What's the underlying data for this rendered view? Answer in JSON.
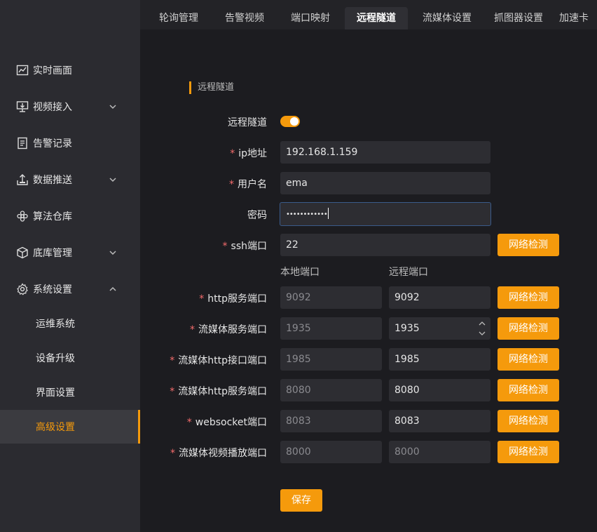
{
  "sidebar": {
    "items": [
      {
        "label": "实时画面",
        "icon": "chart-line-icon"
      },
      {
        "label": "视频接入",
        "icon": "monitor-icon"
      },
      {
        "label": "告警记录",
        "icon": "document-icon"
      },
      {
        "label": "数据推送",
        "icon": "upload-icon"
      },
      {
        "label": "算法仓库",
        "icon": "flower-icon"
      },
      {
        "label": "底库管理",
        "icon": "cube-icon"
      },
      {
        "label": "系统设置",
        "icon": "gear-icon"
      }
    ],
    "subitems": [
      {
        "label": "运维系统"
      },
      {
        "label": "设备升级"
      },
      {
        "label": "界面设置"
      },
      {
        "label": "高级设置"
      }
    ]
  },
  "tabs": [
    "轮询管理",
    "告警视频",
    "端口映射",
    "远程隧道",
    "流媒体设置",
    "抓图器设置",
    "加速卡"
  ],
  "active_tab": "远程隧道",
  "section_title": "远程隧道",
  "form": {
    "tunnel_label": "远程隧道",
    "tunnel_enabled": true,
    "ip_label": "ip地址",
    "ip_value": "192.168.1.159",
    "user_label": "用户名",
    "user_value": "ema",
    "password_label": "密码",
    "password_value": "••••••••••••",
    "ssh_label": "ssh端口",
    "ssh_value": "22",
    "local_port_header": "本地端口",
    "remote_port_header": "远程端口",
    "rows": [
      {
        "label": "http服务端口",
        "local": "9092",
        "remote": "9092"
      },
      {
        "label": "流媒体服务端口",
        "local": "1935",
        "remote": "1935"
      },
      {
        "label": "流媒体http接口端口",
        "local": "1985",
        "remote": "1985"
      },
      {
        "label": "流媒体http服务端口",
        "local": "8080",
        "remote": "8080"
      },
      {
        "label": "websocket端口",
        "local": "8083",
        "remote": "8083"
      },
      {
        "label": "流媒体视频播放端口",
        "local": "8000",
        "remote": "8000"
      }
    ],
    "check_label": "网络检测",
    "save_label": "保存",
    "required_mark": "*"
  },
  "colors": {
    "accent": "#f59a0c",
    "required": "#f56c6c",
    "sidebar_bg": "#2b2b30",
    "main_bg": "#1c1c20"
  }
}
